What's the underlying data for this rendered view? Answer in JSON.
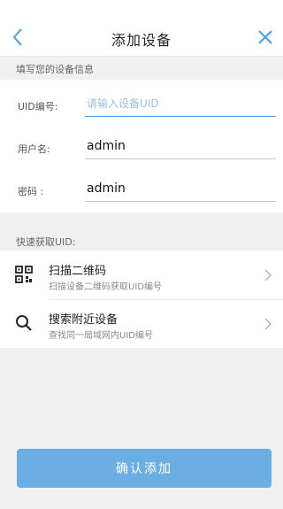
{
  "header": {
    "title": "添加设备",
    "back_icon": "chevron-left-icon",
    "close_icon": "close-icon"
  },
  "device_info": {
    "section_label": "填写您的设备信息",
    "uid": {
      "label": "UID编号:",
      "placeholder": "请输入设备UID",
      "value": ""
    },
    "username": {
      "label": "用户名:",
      "value": "admin"
    },
    "password": {
      "label": "密码 :",
      "value": "admin"
    }
  },
  "quick": {
    "section_label": "快速获取UID:",
    "items": [
      {
        "title": "扫描二维码",
        "subtitle": "扫描设备二维码获取UID编号",
        "icon": "qr-code-icon"
      },
      {
        "title": "搜索附近设备",
        "subtitle": "查找同一局域网内UID编号",
        "icon": "search-icon"
      }
    ]
  },
  "confirm_label": "确认添加",
  "colors": {
    "accent": "#4a9fd8",
    "button": "#6aaee3"
  }
}
